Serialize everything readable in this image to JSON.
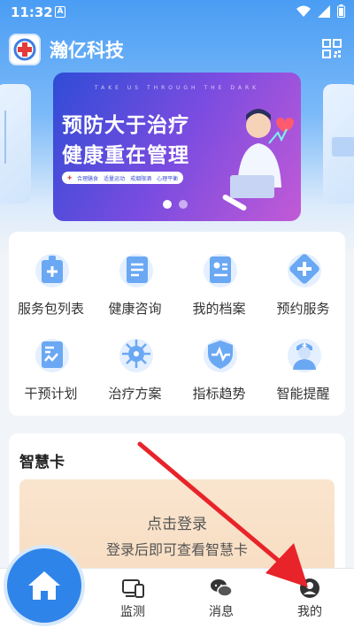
{
  "status_bar": {
    "time": "11:32",
    "notification_glyph": "A"
  },
  "header": {
    "title": "瀚亿科技"
  },
  "banner": {
    "top_caption": "TAKE US THROUGH THE DARK",
    "headline_1": "预防大于治疗",
    "headline_2": "健康重在管理",
    "strip_items": [
      "合理膳食",
      "适量运动",
      "戒烟限酒",
      "心理平衡"
    ],
    "active_dot": 0
  },
  "services": [
    {
      "label": "服务包列表",
      "icon": "service-package-icon"
    },
    {
      "label": "健康咨询",
      "icon": "consult-scroll-icon"
    },
    {
      "label": "我的档案",
      "icon": "profile-card-icon"
    },
    {
      "label": "预约服务",
      "icon": "appointment-cross-icon"
    },
    {
      "label": "干预计划",
      "icon": "intervention-chart-icon"
    },
    {
      "label": "治疗方案",
      "icon": "virus-icon"
    },
    {
      "label": "指标趋势",
      "icon": "heartbeat-shield-icon"
    },
    {
      "label": "智能提醒",
      "icon": "nurse-icon"
    }
  ],
  "smart_card": {
    "title": "智慧卡",
    "login_prompt": "点击登录",
    "login_hint": "登录后即可查看智慧卡"
  },
  "tabbar": {
    "home": {
      "icon": "home-icon"
    },
    "monitor": {
      "label": "监测",
      "icon": "devices-icon"
    },
    "messages": {
      "label": "消息",
      "icon": "chat-bubbles-icon"
    },
    "mine": {
      "label": "我的",
      "icon": "person-icon"
    }
  },
  "colors": {
    "primary": "#2f84ea",
    "header_bg": "#4a9df4",
    "annotation_arrow": "#e8232a"
  }
}
